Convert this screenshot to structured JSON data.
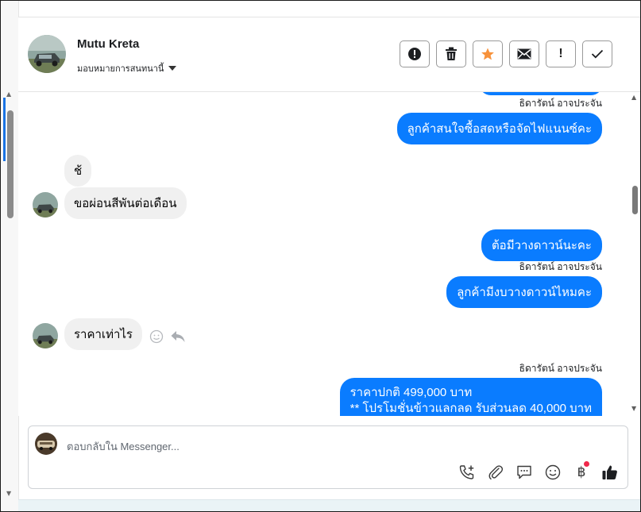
{
  "header": {
    "contact_name": "Mutu Kreta",
    "assign_label": "มอบหมายการสนทนานี้",
    "actions": [
      {
        "name": "spam",
        "icon": "alert-circle-icon"
      },
      {
        "name": "delete",
        "icon": "trash-icon"
      },
      {
        "name": "star",
        "icon": "star-icon"
      },
      {
        "name": "mark-unread",
        "icon": "envelope-icon"
      },
      {
        "name": "follow-up",
        "icon": "exclamation-icon",
        "label": "!"
      },
      {
        "name": "done",
        "icon": "check-icon"
      }
    ],
    "star_color": "#f7923b"
  },
  "conversation": {
    "messages": [
      {
        "id": "m1",
        "direction": "outgoing",
        "sender": "ธิดารัตน์ อาจประจัน",
        "text": "ลูกค้าสนใจซื้อสดหรือจัดไฟแนนซ์คะ"
      },
      {
        "id": "m2",
        "direction": "incoming",
        "text": "ช้"
      },
      {
        "id": "m3",
        "direction": "incoming",
        "text": "ขอผ่อนสีพันต่อเดือน"
      },
      {
        "id": "m4",
        "direction": "outgoing",
        "text": "ต้อมีวางดาวน์นะคะ"
      },
      {
        "id": "m5",
        "direction": "outgoing",
        "sender": "ธิดารัตน์ อาจประจัน",
        "text": "ลูกค้ามีงบวางดาวน์ไหมคะ"
      },
      {
        "id": "m6",
        "direction": "incoming",
        "text": "ราคาเท่าไร"
      },
      {
        "id": "m7",
        "direction": "outgoing",
        "sender": "ธิดารัตน์ อาจประจัน",
        "lines": [
          "ราคาปกติ 499,000 บาท",
          "** โปรโมชั่นข้าวแลกลด รับส่วนลด 40,000 บาท"
        ]
      }
    ],
    "hover_icons": [
      "smiley-icon",
      "reply-icon"
    ]
  },
  "composer": {
    "placeholder": "ตอบกลับใน Messenger...",
    "tools": [
      "phone-plus-icon",
      "paperclip-icon",
      "saved-reply-icon",
      "emoji-icon",
      "baht-icon",
      "thumbs-up-icon"
    ],
    "baht_symbol": "฿",
    "accent": "#0a7cff"
  }
}
